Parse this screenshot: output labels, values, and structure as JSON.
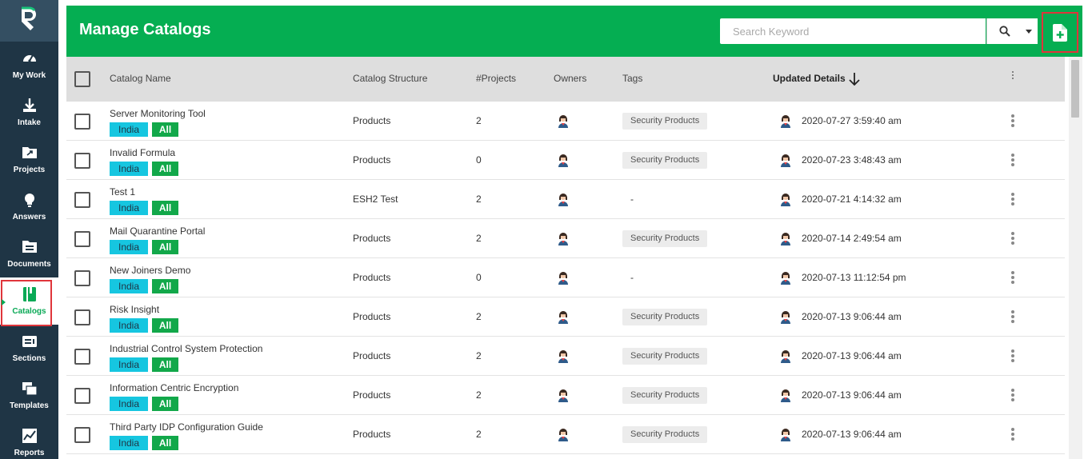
{
  "sidebar": {
    "items": [
      {
        "label": "My Work",
        "icon": "gauge-icon"
      },
      {
        "label": "Intake",
        "icon": "download-icon"
      },
      {
        "label": "Projects",
        "icon": "folder-arrow-icon"
      },
      {
        "label": "Answers",
        "icon": "lightbulb-icon"
      },
      {
        "label": "Documents",
        "icon": "documents-icon"
      },
      {
        "label": "Catalogs",
        "icon": "catalog-icon"
      },
      {
        "label": "Sections",
        "icon": "sections-icon"
      },
      {
        "label": "Templates",
        "icon": "templates-icon"
      },
      {
        "label": "Reports",
        "icon": "chart-line-icon"
      }
    ],
    "active": "Catalogs"
  },
  "header": {
    "title": "Manage Catalogs",
    "search_placeholder": "Search Keyword"
  },
  "table": {
    "columns": [
      "Catalog Name",
      "Catalog Structure",
      "#Projects",
      "Owners",
      "Tags",
      "Updated Details"
    ],
    "sort_column": "Updated Details",
    "sort_direction": "descending",
    "rows": [
      {
        "name": "Server Monitoring Tool",
        "region": "India",
        "scope": "All",
        "structure": "Products",
        "projects": "2",
        "tag": "Security Products",
        "updated": "2020-07-27 3:59:40 am"
      },
      {
        "name": "Invalid Formula",
        "region": "India",
        "scope": "All",
        "structure": "Products",
        "projects": "0",
        "tag": "Security Products",
        "updated": "2020-07-23 3:48:43 am"
      },
      {
        "name": "Test 1",
        "region": "India",
        "scope": "All",
        "structure": "ESH2 Test",
        "projects": "2",
        "tag": "-",
        "updated": "2020-07-21 4:14:32 am"
      },
      {
        "name": "Mail Quarantine Portal",
        "region": "India",
        "scope": "All",
        "structure": "Products",
        "projects": "2",
        "tag": "Security Products",
        "updated": "2020-07-14 2:49:54 am"
      },
      {
        "name": "New Joiners Demo",
        "region": "India",
        "scope": "All",
        "structure": "Products",
        "projects": "0",
        "tag": "-",
        "updated": "2020-07-13 11:12:54 pm"
      },
      {
        "name": "Risk Insight",
        "region": "India",
        "scope": "All",
        "structure": "Products",
        "projects": "2",
        "tag": "Security Products",
        "updated": "2020-07-13 9:06:44 am"
      },
      {
        "name": "Industrial Control System Protection",
        "region": "India",
        "scope": "All",
        "structure": "Products",
        "projects": "2",
        "tag": "Security Products",
        "updated": "2020-07-13 9:06:44 am"
      },
      {
        "name": "Information Centric Encryption",
        "region": "India",
        "scope": "All",
        "structure": "Products",
        "projects": "2",
        "tag": "Security Products",
        "updated": "2020-07-13 9:06:44 am"
      },
      {
        "name": "Third Party IDP Configuration Guide",
        "region": "India",
        "scope": "All",
        "structure": "Products",
        "projects": "2",
        "tag": "Security Products",
        "updated": "2020-07-13 9:06:44 am"
      }
    ]
  },
  "colors": {
    "sidebar_bg": "#1f3545",
    "header_green": "#05ae52",
    "badge_cyan": "#16c6e0",
    "badge_green": "#12a84a",
    "highlight_red": "#e0353b"
  }
}
